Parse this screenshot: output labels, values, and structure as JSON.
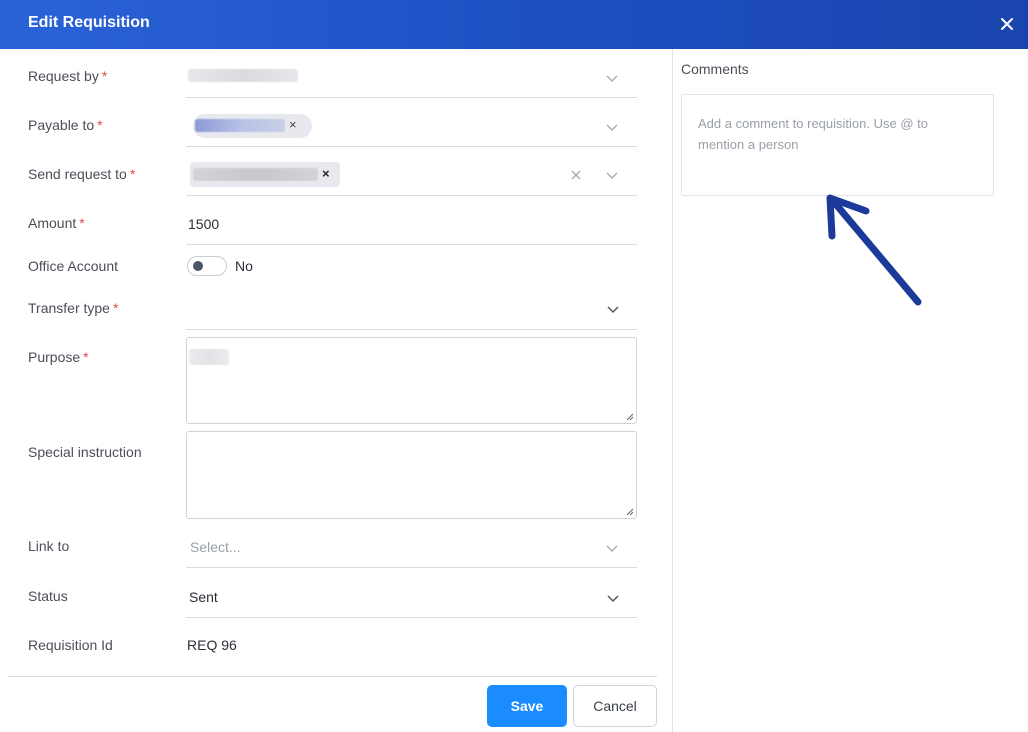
{
  "header": {
    "title": "Edit Requisition"
  },
  "form": {
    "request_by": {
      "label": "Request by",
      "required_mark": "*"
    },
    "payable_to": {
      "label": "Payable to",
      "required_mark": "*",
      "chip_remove": "×"
    },
    "send_request_to": {
      "label": "Send request to",
      "required_mark": "*",
      "chip_remove": "×",
      "clear": "×"
    },
    "amount": {
      "label": "Amount",
      "required_mark": "*",
      "value": "1500"
    },
    "office_account": {
      "label": "Office Account",
      "toggle_text": "No",
      "toggle_on": false
    },
    "transfer_type": {
      "label": "Transfer type",
      "required_mark": "*"
    },
    "purpose": {
      "label": "Purpose",
      "required_mark": "*"
    },
    "special_instruction": {
      "label": "Special instruction"
    },
    "link_to": {
      "label": "Link to",
      "placeholder": "Select..."
    },
    "status": {
      "label": "Status",
      "value": "Sent"
    },
    "requisition_id": {
      "label": "Requisition Id",
      "value": "REQ 96"
    }
  },
  "actions": {
    "save_label": "Save",
    "cancel_label": "Cancel"
  },
  "comments": {
    "title": "Comments",
    "placeholder": "Add a comment to requisition. Use @ to mention a person"
  },
  "colors": {
    "header": "#1d4fc2",
    "save": "#1a8cff",
    "required": "#e5484d",
    "arrow": "#1b3a9a"
  },
  "icons": {
    "close": "close-icon",
    "chevron": "chevron-down-icon",
    "arrow": "arrow-annotation-icon"
  }
}
